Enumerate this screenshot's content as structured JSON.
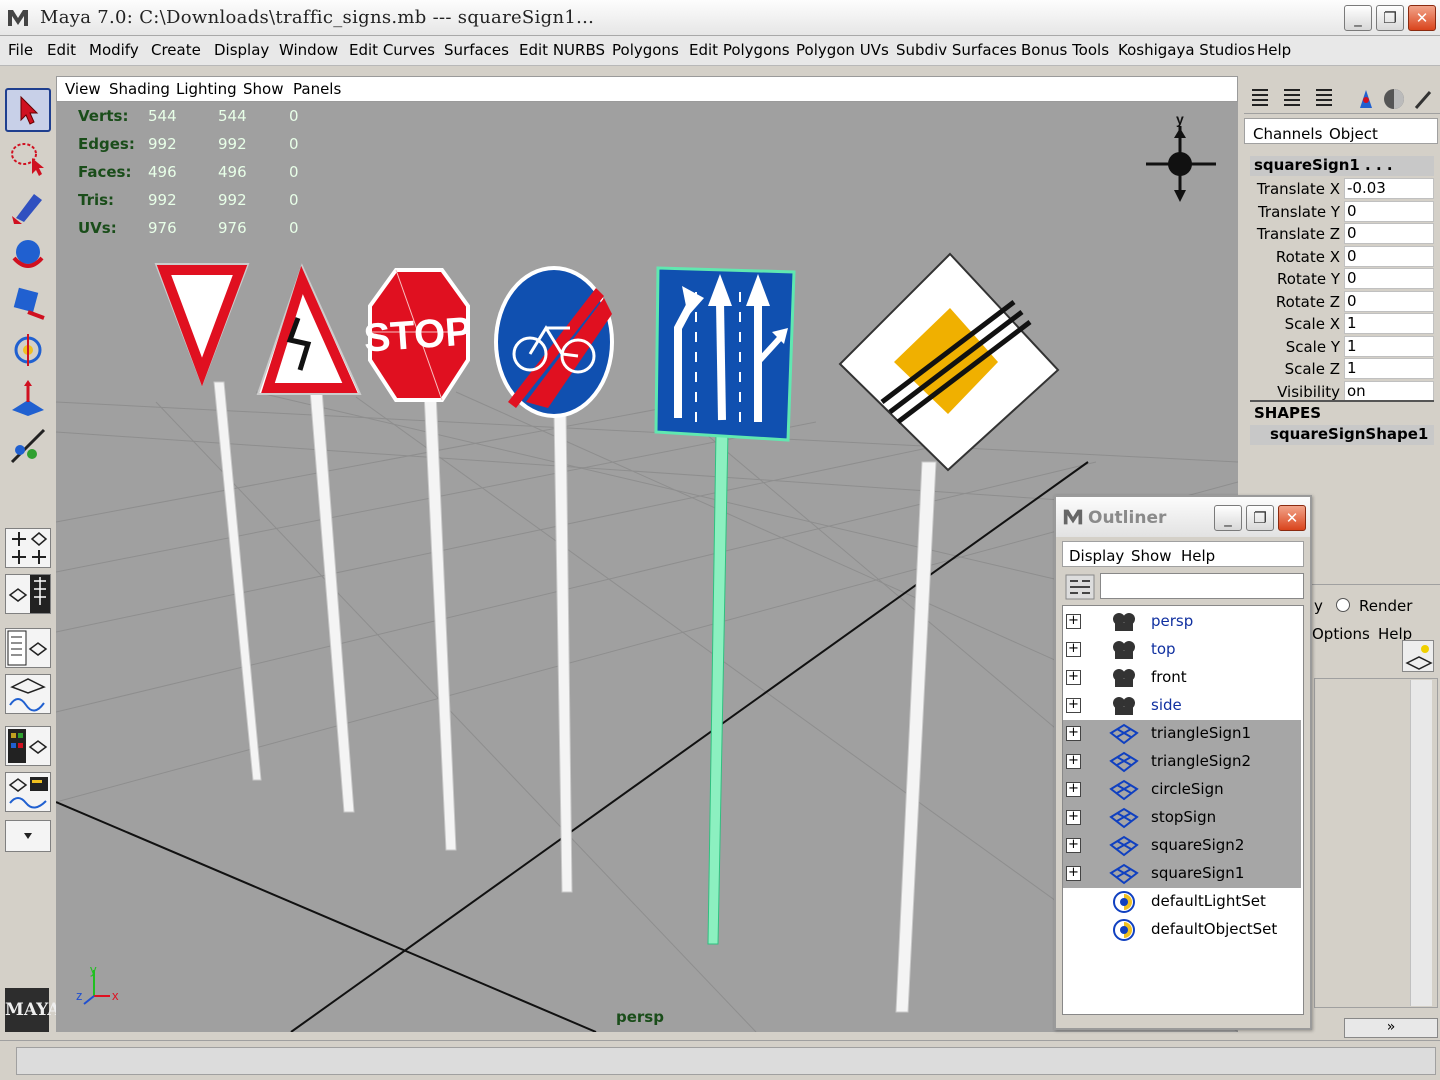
{
  "window": {
    "title": "Maya 7.0: C:\\Downloads\\traffic_signs.mb   ---   squareSign1...",
    "minimize": "_",
    "maximize": "❐",
    "close": "✕"
  },
  "menu": [
    "File",
    "Edit",
    "Modify",
    "Create",
    "Display",
    "Window",
    "Edit Curves",
    "Surfaces",
    "Edit NURBS",
    "Polygons",
    "Edit Polygons",
    "Polygon UVs",
    "Subdiv Surfaces",
    "Bonus Tools",
    "Koshigaya Studios",
    "Help"
  ],
  "panel_menu": [
    "View",
    "Shading",
    "Lighting",
    "Show",
    "Panels"
  ],
  "hud": {
    "rows": [
      {
        "label": "Verts:",
        "a": "544",
        "b": "544",
        "c": "0"
      },
      {
        "label": "Edges:",
        "a": "992",
        "b": "992",
        "c": "0"
      },
      {
        "label": "Faces:",
        "a": "496",
        "b": "496",
        "c": "0"
      },
      {
        "label": "Tris:",
        "a": "992",
        "b": "992",
        "c": "0"
      },
      {
        "label": "UVs:",
        "a": "976",
        "b": "976",
        "c": "0"
      }
    ]
  },
  "viewport": {
    "camera": "persp",
    "axis_y": "y",
    "axis_x": "x",
    "axis_z": "z",
    "stop_text": "STOP"
  },
  "logo": "MAYA",
  "channel_box": {
    "tabs": [
      "Channels",
      "Object"
    ],
    "object_name": "squareSign1 . . .",
    "attributes": [
      {
        "name": "Translate X",
        "value": "-0.03"
      },
      {
        "name": "Translate Y",
        "value": "0"
      },
      {
        "name": "Translate Z",
        "value": "0"
      },
      {
        "name": "Rotate X",
        "value": "0"
      },
      {
        "name": "Rotate Y",
        "value": "0"
      },
      {
        "name": "Rotate Z",
        "value": "0"
      },
      {
        "name": "Scale X",
        "value": "1"
      },
      {
        "name": "Scale Y",
        "value": "1"
      },
      {
        "name": "Scale Z",
        "value": "1"
      },
      {
        "name": "Visibility",
        "value": "on"
      }
    ],
    "shapes_header": "SHAPES",
    "shape_name": "squareSignShape1",
    "layer_partial_y": "y",
    "layer_render": "Render",
    "layer_options": "Options",
    "layer_help": "Help",
    "scroll_more": "»"
  },
  "outliner": {
    "title": "Outliner",
    "menu": [
      "Display",
      "Show",
      "Help"
    ],
    "filter_value": "",
    "items": [
      {
        "label": "persp",
        "type": "camera",
        "selected": false,
        "expandable": true
      },
      {
        "label": "top",
        "type": "camera",
        "selected": false,
        "expandable": true
      },
      {
        "label": "front",
        "type": "camera",
        "selected": false,
        "expandable": true
      },
      {
        "label": "side",
        "type": "camera",
        "selected": false,
        "expandable": true
      },
      {
        "label": "triangleSign1",
        "type": "mesh",
        "selected": true,
        "expandable": true
      },
      {
        "label": "triangleSign2",
        "type": "mesh",
        "selected": true,
        "expandable": true
      },
      {
        "label": "circleSign",
        "type": "mesh",
        "selected": true,
        "expandable": true
      },
      {
        "label": "stopSign",
        "type": "mesh",
        "selected": true,
        "expandable": true
      },
      {
        "label": "squareSign2",
        "type": "mesh",
        "selected": true,
        "expandable": true
      },
      {
        "label": "squareSign1",
        "type": "mesh",
        "selected": true,
        "expandable": true
      },
      {
        "label": "defaultLightSet",
        "type": "set",
        "selected": false,
        "expandable": false
      },
      {
        "label": "defaultObjectSet",
        "type": "set",
        "selected": false,
        "expandable": false
      }
    ]
  },
  "colors": {
    "viewport_bg": "#a0a0a0",
    "hud_label": "#1a4d1a",
    "selection_highlight": "#60e8b0",
    "sign_red": "#e01020",
    "sign_blue": "#1050b0",
    "sign_yellow": "#f0b000"
  }
}
